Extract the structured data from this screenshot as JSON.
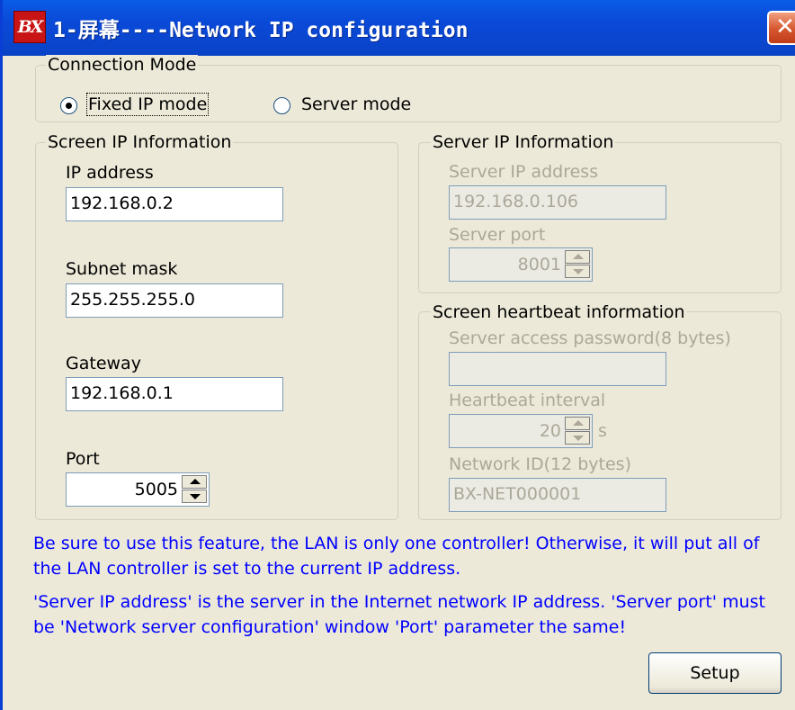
{
  "window": {
    "logo": "BX",
    "title": "1-屏幕----Network IP configuration",
    "close_glyph": "✕"
  },
  "connection_mode": {
    "legend": "Connection Mode",
    "options": [
      {
        "label": "Fixed IP mode",
        "checked": true
      },
      {
        "label": "Server mode",
        "checked": false
      }
    ]
  },
  "screen_ip": {
    "legend": "Screen IP Information",
    "ip_label": "IP address",
    "ip_value": "192.168.0.2",
    "subnet_label": "Subnet mask",
    "subnet_value": "255.255.255.0",
    "gateway_label": "Gateway",
    "gateway_value": "192.168.0.1",
    "port_label": "Port",
    "port_value": "5005"
  },
  "server_ip": {
    "legend": "Server IP Information",
    "address_label": "Server IP address",
    "address_value": "192.168.0.106",
    "port_label": "Server port",
    "port_value": "8001"
  },
  "heartbeat": {
    "legend": "Screen heartbeat information",
    "password_label": "Server access password(8 bytes)",
    "password_value": "",
    "interval_label": "Heartbeat interval",
    "interval_value": "20",
    "interval_unit": "s",
    "network_id_label": "Network ID(12 bytes)",
    "network_id_value": "BX-NET000001"
  },
  "notes": {
    "line1": "Be sure to use this feature, the LAN is only one controller! Otherwise, it will put all of",
    "line2": "the LAN controller is set to the current IP address.",
    "line3": "'Server IP address' is the server in the Internet network IP address. 'Server port' must",
    "line4": "be 'Network server configuration' window 'Port' parameter the same!"
  },
  "buttons": {
    "setup": "Setup"
  },
  "colors": {
    "titlebar": "#0a49d8",
    "note_text": "#0000ff",
    "disabled_text": "#aca899"
  }
}
